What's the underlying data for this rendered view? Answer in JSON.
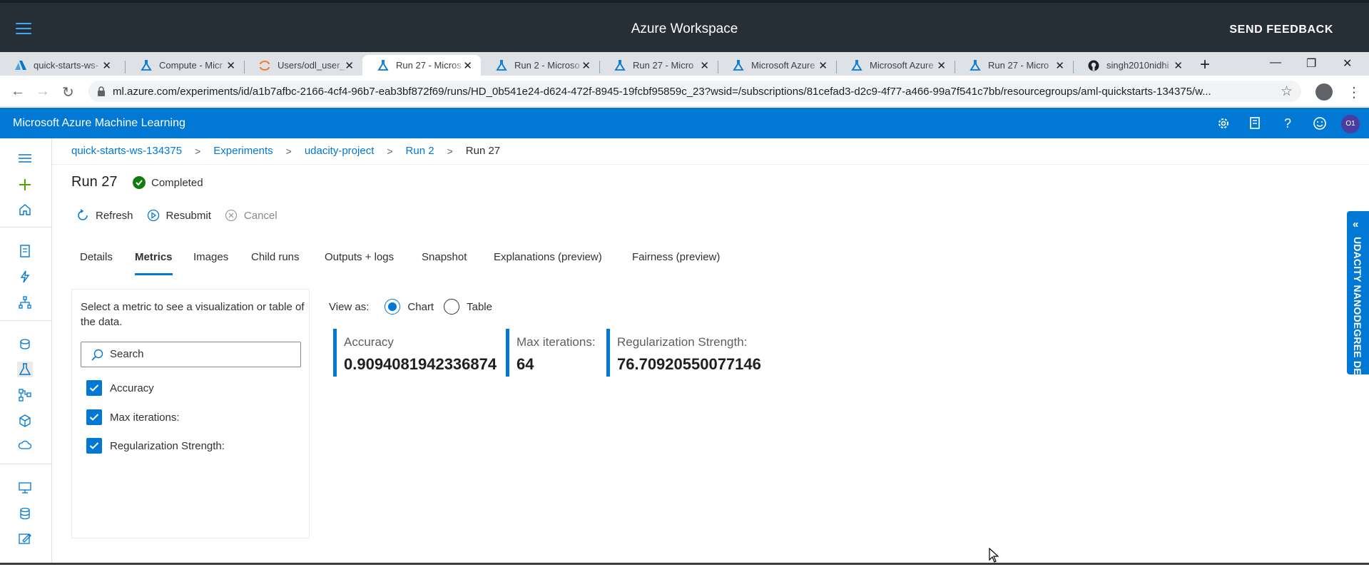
{
  "workspace": {
    "title": "Azure Workspace",
    "feedback_label": "SEND FEEDBACK"
  },
  "browser": {
    "tabs": [
      {
        "label": "quick-starts-ws-"
      },
      {
        "label": "Compute - Micr"
      },
      {
        "label": "Users/odl_user_"
      },
      {
        "label": "Run 27 - Micros"
      },
      {
        "label": "Run 2 - Microso"
      },
      {
        "label": "Run 27 - Micro"
      },
      {
        "label": "Microsoft Azure"
      },
      {
        "label": "Microsoft Azure"
      },
      {
        "label": "Run 27 - Micro"
      },
      {
        "label": "singh2010nidhi"
      }
    ],
    "url": "ml.azure.com/experiments/id/a1b7afbc-2166-4cf4-96b7-eab3bf872f69/runs/HD_0b541e24-d624-472f-8945-19fcbf95859c_23?wsid=/subscriptions/81cefad3-d2c9-4f77-a466-99a7f541c7bb/resourcegroups/aml-quickstarts-134375/w..."
  },
  "aml": {
    "brand": "Microsoft Azure Machine Learning",
    "avatar_initials": "O1"
  },
  "breadcrumb": {
    "items": [
      "quick-starts-ws-134375",
      "Experiments",
      "udacity-project",
      "Run 2"
    ],
    "current": "Run 27"
  },
  "run": {
    "title": "Run 27",
    "status": "Completed"
  },
  "commands": {
    "refresh": "Refresh",
    "resubmit": "Resubmit",
    "cancel": "Cancel"
  },
  "tabs": [
    "Details",
    "Metrics",
    "Images",
    "Child runs",
    "Outputs + logs",
    "Snapshot",
    "Explanations (preview)",
    "Fairness (preview)"
  ],
  "metrics_panel": {
    "hint": "Select a metric to see a visualization or table of the data.",
    "search_placeholder": "Search",
    "items": [
      "Accuracy",
      "Max iterations:",
      "Regularization Strength:"
    ]
  },
  "view_as": {
    "label": "View as:",
    "chart": "Chart",
    "table": "Table",
    "selected": "Chart"
  },
  "metric_cards": [
    {
      "label": "Accuracy",
      "value": "0.9094081942336874"
    },
    {
      "label": "Max iterations:",
      "value": "64"
    },
    {
      "label": "Regularization Strength:",
      "value": "76.70920550077146"
    }
  ],
  "side_panel": {
    "label": "UDACITY NANODEGREE DEMO"
  },
  "colors": {
    "accent": "#0078d4",
    "success": "#107c10",
    "header_dark": "#262e36"
  }
}
